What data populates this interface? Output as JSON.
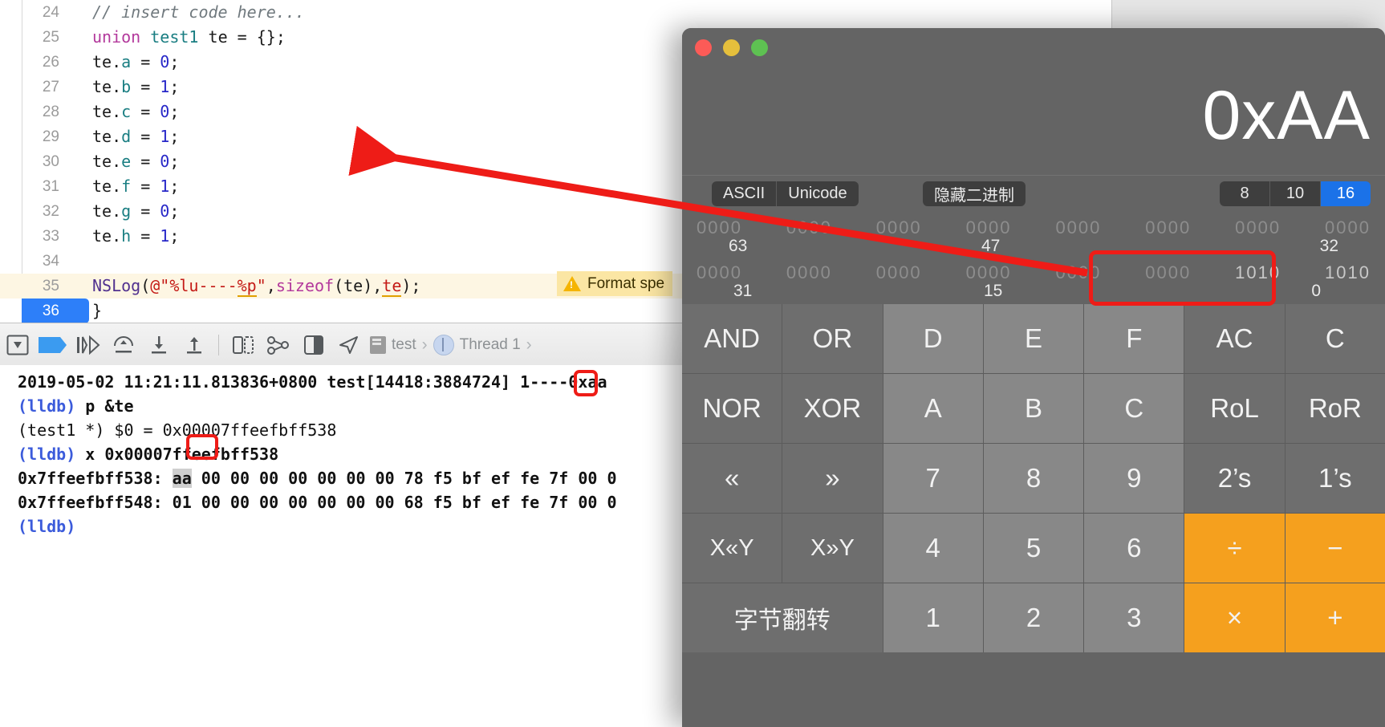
{
  "editor": {
    "lines": [
      {
        "num": "24",
        "kind": "comment",
        "text": "// insert code here..."
      },
      {
        "num": "25",
        "kind": "decl",
        "text": "union test1 te = {};"
      },
      {
        "num": "26",
        "kind": "assign",
        "text": "te.a = 0;"
      },
      {
        "num": "27",
        "kind": "assign",
        "text": "te.b = 1;"
      },
      {
        "num": "28",
        "kind": "assign",
        "text": "te.c = 0;"
      },
      {
        "num": "29",
        "kind": "assign",
        "text": "te.d = 1;"
      },
      {
        "num": "30",
        "kind": "assign",
        "text": "te.e = 0;"
      },
      {
        "num": "31",
        "kind": "assign",
        "text": "te.f = 1;"
      },
      {
        "num": "32",
        "kind": "assign",
        "text": "te.g = 0;"
      },
      {
        "num": "33",
        "kind": "assign",
        "text": "te.h = 1;"
      },
      {
        "num": "34",
        "kind": "blank",
        "text": ""
      },
      {
        "num": "35",
        "kind": "nslog",
        "text": "NSLog(@\"%lu----%p\",sizeof(te),te);"
      },
      {
        "num": "36",
        "kind": "brace",
        "text": "}"
      }
    ],
    "warning": "Format spe"
  },
  "debug_toolbar": {
    "breadcrumb_process": "test",
    "breadcrumb_thread": "Thread 1",
    "icons": [
      "hide-debug-area-icon",
      "breakpoints-icon",
      "continue-icon",
      "step-over-icon",
      "step-into-icon",
      "step-out-icon",
      "debug-view-hierarchy-icon",
      "memory-graph-icon",
      "environment-overrides-icon",
      "location-icon"
    ]
  },
  "console": {
    "lines": [
      {
        "id": "log",
        "text": "2019-05-02 11:21:11.813836+0800 test[14418:3884724] 1----0xaa"
      },
      {
        "id": "cmd1",
        "prompt": "(lldb)",
        "text": " p &te"
      },
      {
        "id": "res1",
        "text": "(test1 *) $0 = 0x00007ffeefbff538"
      },
      {
        "id": "cmd2",
        "prompt": "(lldb)",
        "text": " x 0x00007ffeefbff538"
      },
      {
        "id": "mem1",
        "text": "0x7ffeefbff538: aa 00 00 00 00 00 00 00 78 f5 bf ef fe 7f 00 0"
      },
      {
        "id": "mem2",
        "text": "0x7ffeefbff548: 01 00 00 00 00 00 00 00 68 f5 bf ef fe 7f 00 0"
      },
      {
        "id": "cmd3",
        "prompt": "(lldb)",
        "text": ""
      }
    ],
    "highlight_digit": "1",
    "highlight_byte": "aa"
  },
  "calculator": {
    "window_title": "",
    "display_value": "0xAA",
    "charset_segments": [
      {
        "label": "ASCII",
        "active": false
      },
      {
        "label": "Unicode",
        "active": false
      }
    ],
    "binary_toggle": {
      "label": "隐藏二进制",
      "active": false
    },
    "base_segments": [
      {
        "label": "8",
        "active": false
      },
      {
        "label": "10",
        "active": false
      },
      {
        "label": "16",
        "active": true
      }
    ],
    "binary_rows": [
      {
        "nibbles": [
          "0000",
          "0000",
          "0000",
          "0000",
          "0000",
          "0000",
          "0000",
          "0000"
        ],
        "labels": {
          "left": "63",
          "middle": "47",
          "right": "32"
        }
      },
      {
        "nibbles": [
          "0000",
          "0000",
          "0000",
          "0000",
          "0000",
          "0000",
          "1010",
          "1010"
        ],
        "labels": {
          "left": "31",
          "middle": "15",
          "right": "0"
        }
      }
    ],
    "keys": [
      [
        {
          "label": "AND",
          "style": "fnk"
        },
        {
          "label": "OR",
          "style": "fnk"
        },
        {
          "label": "D",
          "style": "numk"
        },
        {
          "label": "E",
          "style": "numk"
        },
        {
          "label": "F",
          "style": "numk"
        },
        {
          "label": "AC",
          "style": "fnk"
        },
        {
          "label": "C",
          "style": "fnk"
        }
      ],
      [
        {
          "label": "NOR",
          "style": "fnk"
        },
        {
          "label": "XOR",
          "style": "fnk"
        },
        {
          "label": "A",
          "style": "numk"
        },
        {
          "label": "B",
          "style": "numk"
        },
        {
          "label": "C",
          "style": "numk"
        },
        {
          "label": "RoL",
          "style": "fnk"
        },
        {
          "label": "RoR",
          "style": "fnk"
        }
      ],
      [
        {
          "label": "«",
          "style": "fnk"
        },
        {
          "label": "»",
          "style": "fnk"
        },
        {
          "label": "7",
          "style": "numk"
        },
        {
          "label": "8",
          "style": "numk"
        },
        {
          "label": "9",
          "style": "numk"
        },
        {
          "label": "2’s",
          "style": "fnk"
        },
        {
          "label": "1’s",
          "style": "fnk"
        }
      ],
      [
        {
          "label": "X«Y",
          "style": "fnk small"
        },
        {
          "label": "X»Y",
          "style": "fnk small"
        },
        {
          "label": "4",
          "style": "numk"
        },
        {
          "label": "5",
          "style": "numk"
        },
        {
          "label": "6",
          "style": "numk"
        },
        {
          "label": "÷",
          "style": "opk"
        },
        {
          "label": "−",
          "style": "opk"
        }
      ],
      [
        {
          "label": "字节翻转",
          "style": "fnk zh",
          "span": 2
        },
        {
          "label": "1",
          "style": "numk"
        },
        {
          "label": "2",
          "style": "numk"
        },
        {
          "label": "3",
          "style": "numk"
        },
        {
          "label": "×",
          "style": "opk"
        },
        {
          "label": "+",
          "style": "opk"
        }
      ]
    ]
  },
  "annotation": {
    "arrow_color": "#ee1c17",
    "box_color": "#ee1c17"
  }
}
